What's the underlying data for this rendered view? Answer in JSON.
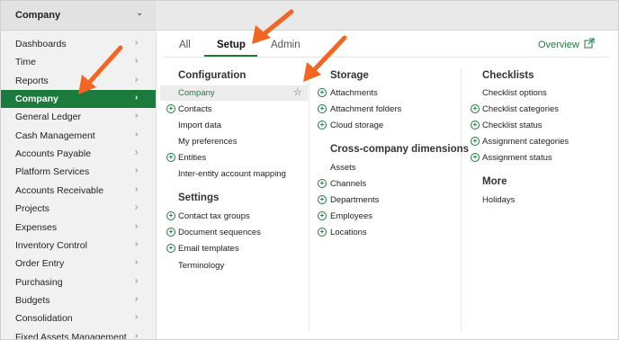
{
  "topbar": {
    "company_label": "Company"
  },
  "sidebar": {
    "items": [
      {
        "label": "Dashboards",
        "active": false
      },
      {
        "label": "Time",
        "active": false
      },
      {
        "label": "Reports",
        "active": false
      },
      {
        "label": "Company",
        "active": true
      },
      {
        "label": "General Ledger",
        "active": false
      },
      {
        "label": "Cash Management",
        "active": false
      },
      {
        "label": "Accounts Payable",
        "active": false
      },
      {
        "label": "Platform Services",
        "active": false
      },
      {
        "label": "Accounts Receivable",
        "active": false
      },
      {
        "label": "Projects",
        "active": false
      },
      {
        "label": "Expenses",
        "active": false
      },
      {
        "label": "Inventory Control",
        "active": false
      },
      {
        "label": "Order Entry",
        "active": false
      },
      {
        "label": "Purchasing",
        "active": false
      },
      {
        "label": "Budgets",
        "active": false
      },
      {
        "label": "Consolidation",
        "active": false
      },
      {
        "label": "Fixed Assets Management",
        "active": false
      }
    ]
  },
  "tabs": [
    {
      "label": "All",
      "active": false
    },
    {
      "label": "Setup",
      "active": true
    },
    {
      "label": "Admin",
      "active": false
    }
  ],
  "overview_label": "Overview",
  "columns": {
    "configuration": {
      "heading": "Configuration",
      "items": [
        {
          "label": "Company",
          "plus": false,
          "selected": true
        },
        {
          "label": "Contacts",
          "plus": true
        },
        {
          "label": "Import data",
          "plus": false
        },
        {
          "label": "My preferences",
          "plus": false
        },
        {
          "label": "Entities",
          "plus": true
        },
        {
          "label": "Inter-entity account mapping",
          "plus": false
        }
      ]
    },
    "settings": {
      "heading": "Settings",
      "items": [
        {
          "label": "Contact tax groups",
          "plus": true
        },
        {
          "label": "Document sequences",
          "plus": true
        },
        {
          "label": "Email templates",
          "plus": true
        },
        {
          "label": "Terminology",
          "plus": false
        }
      ]
    },
    "storage": {
      "heading": "Storage",
      "items": [
        {
          "label": "Attachments",
          "plus": true
        },
        {
          "label": "Attachment folders",
          "plus": true
        },
        {
          "label": "Cloud storage",
          "plus": true
        }
      ]
    },
    "cross_company": {
      "heading": "Cross-company dimensions",
      "items": [
        {
          "label": "Assets",
          "plus": false
        },
        {
          "label": "Channels",
          "plus": true
        },
        {
          "label": "Departments",
          "plus": true
        },
        {
          "label": "Employees",
          "plus": true
        },
        {
          "label": "Locations",
          "plus": true
        }
      ]
    },
    "checklists": {
      "heading": "Checklists",
      "items": [
        {
          "label": "Checklist options",
          "plus": false
        },
        {
          "label": "Checklist categories",
          "plus": true
        },
        {
          "label": "Checklist status",
          "plus": true
        },
        {
          "label": "Assignment categories",
          "plus": true
        },
        {
          "label": "Assignment status",
          "plus": true
        }
      ]
    },
    "more": {
      "heading": "More",
      "items": [
        {
          "label": "Holidays",
          "plus": false
        }
      ]
    }
  },
  "colors": {
    "accent": "#1a7b3c",
    "arrow": "#f26522",
    "sidebar_bg": "#f1f1f1"
  }
}
